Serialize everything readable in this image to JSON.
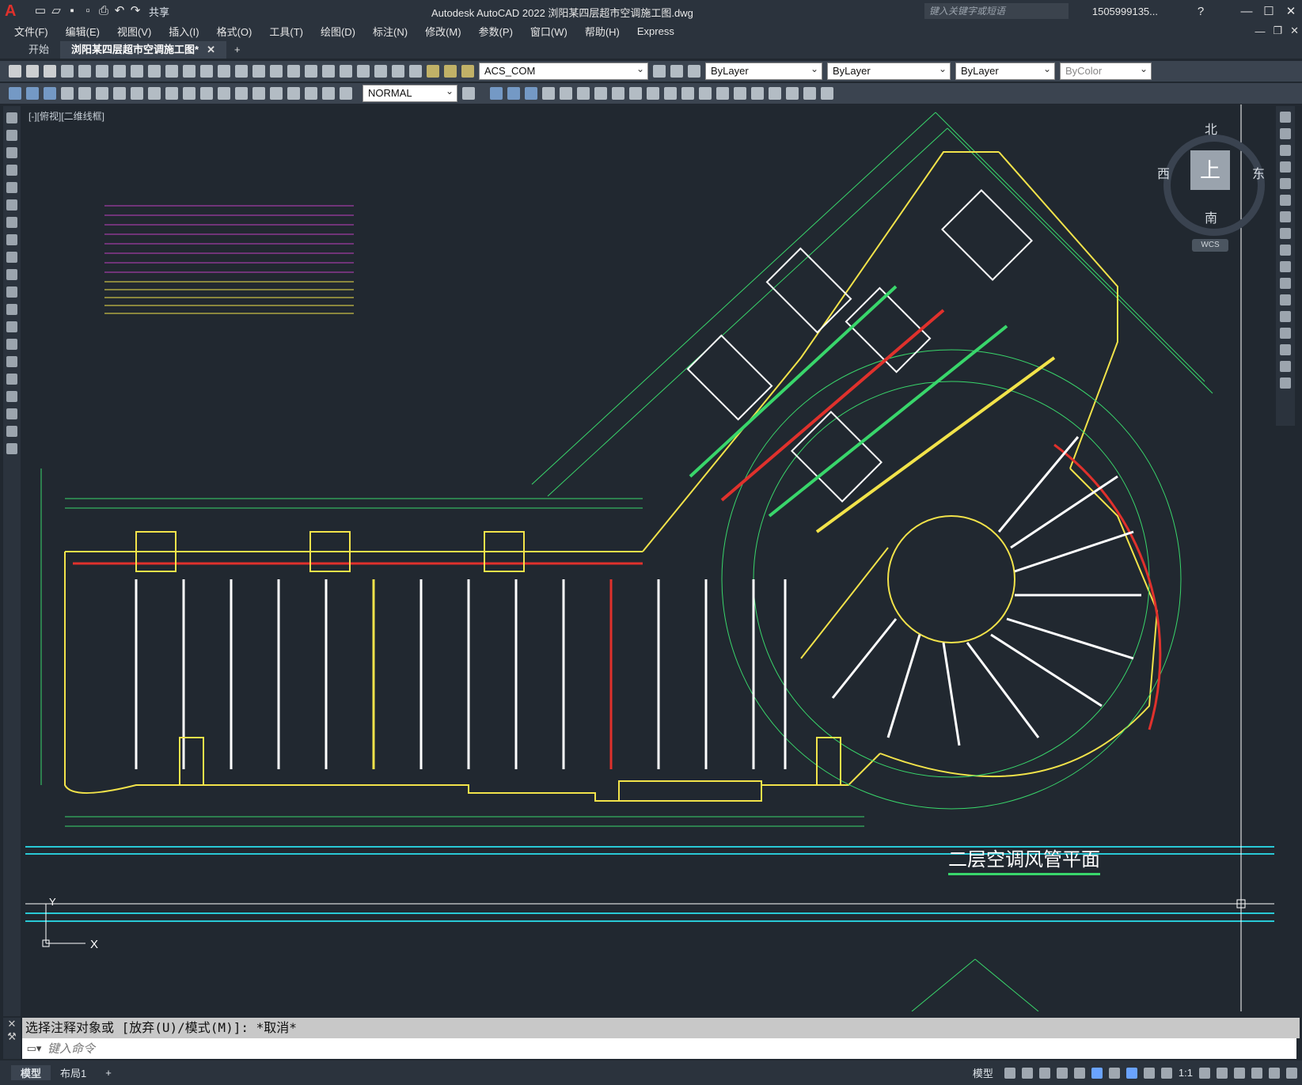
{
  "app": {
    "window_title": "Autodesk AutoCAD 2022    浏阳某四层超市空调施工图.dwg",
    "share_label": "共享",
    "search_placeholder": "键入关键字或短语",
    "user": "1505999135..."
  },
  "menu": [
    "文件(F)",
    "编辑(E)",
    "视图(V)",
    "插入(I)",
    "格式(O)",
    "工具(T)",
    "绘图(D)",
    "标注(N)",
    "修改(M)",
    "参数(P)",
    "窗口(W)",
    "帮助(H)",
    "Express"
  ],
  "tabs": {
    "start": "开始",
    "active": "浏阳某四层超市空调施工图*"
  },
  "toolbar": {
    "layer": "ACS_COM",
    "color": "ByLayer",
    "linetype": "ByLayer",
    "lineweight": "ByLayer",
    "plotstyle": "ByColor",
    "dimstyle": "NORMAL"
  },
  "viewport": {
    "label": "[-][俯视][二维线框]",
    "compass": {
      "north": "北",
      "south": "南",
      "east": "东",
      "west": "西",
      "top": "上"
    },
    "wcs": "WCS"
  },
  "drawing": {
    "title": "二层空调风管平面",
    "axis_x": "X",
    "axis_y": "Y"
  },
  "command": {
    "history": "选择注释对象或 [放弃(U)/模式(M)]: *取消*",
    "placeholder": "键入命令"
  },
  "status": {
    "tabs": [
      "模型",
      "布局1"
    ],
    "model_label": "模型",
    "scale": "1:1"
  },
  "colors": {
    "background": "#212830",
    "drawing_green": "#39d66b",
    "drawing_yellow": "#f2e34a",
    "drawing_white": "#ffffff",
    "drawing_red": "#e0312c"
  }
}
